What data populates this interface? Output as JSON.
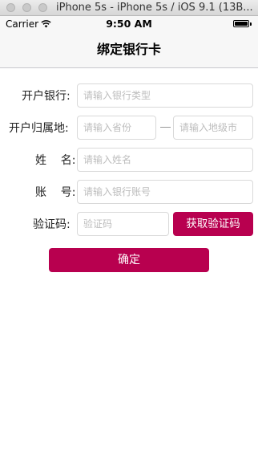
{
  "window": {
    "title": "iPhone 5s - iPhone 5s / iOS 9.1 (13B..."
  },
  "status_bar": {
    "carrier": "Carrier",
    "time": "9:50 AM"
  },
  "nav": {
    "title": "绑定银行卡"
  },
  "form": {
    "bank": {
      "label": "开户银行:",
      "placeholder": "请输入银行类型",
      "value": ""
    },
    "location": {
      "label": "开户归属地:",
      "province_placeholder": "请输入省份",
      "province_value": "",
      "separator": "—",
      "city_placeholder": "请输入地级市",
      "city_value": ""
    },
    "name": {
      "label": "姓    名:",
      "placeholder": "请输入姓名",
      "value": ""
    },
    "account": {
      "label": "账    号:",
      "placeholder": "请输入银行账号",
      "value": ""
    },
    "code": {
      "label": "验证码:",
      "placeholder": "验证码",
      "value": "",
      "button_label": "获取验证码"
    },
    "confirm_label": "确定"
  },
  "colors": {
    "accent": "#b8004f",
    "background": "#ffffff",
    "bar": "#f7f7f7"
  },
  "icons": {
    "wifi": "wifi-icon",
    "battery": "battery-icon"
  }
}
